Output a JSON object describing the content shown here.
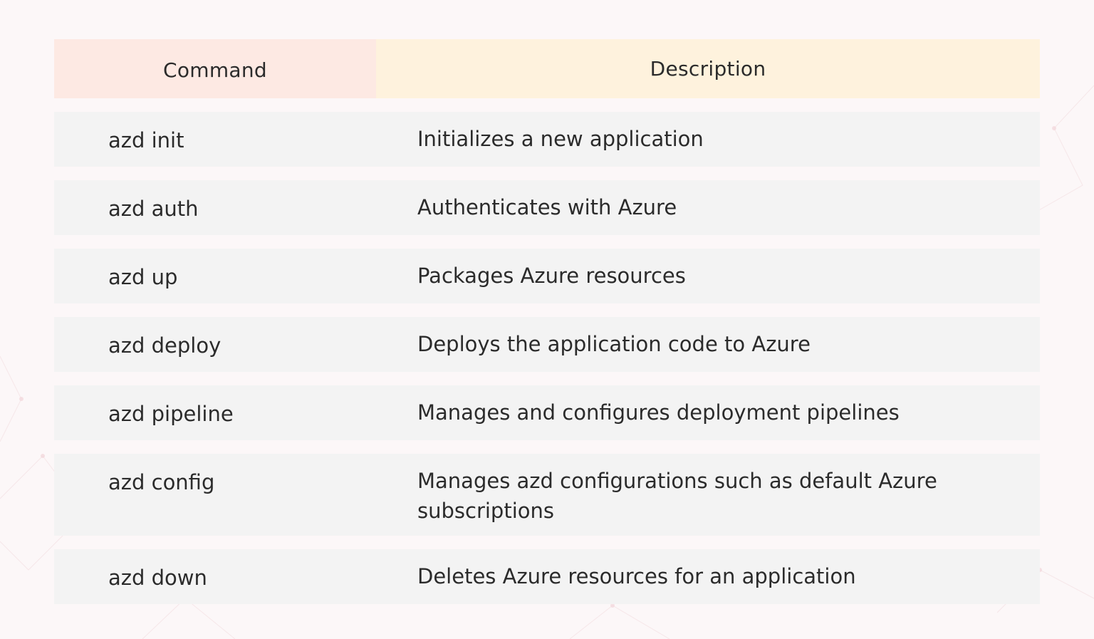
{
  "table": {
    "headers": {
      "command": "Command",
      "description": "Description"
    },
    "rows": [
      {
        "command": "azd init",
        "description": "Initializes a new application"
      },
      {
        "command": "azd auth",
        "description": "Authenticates with Azure"
      },
      {
        "command": "azd up",
        "description": "Packages Azure resources"
      },
      {
        "command": "azd deploy",
        "description": "Deploys the application code to Azure"
      },
      {
        "command": "azd pipeline",
        "description": "Manages and configures deployment pipelines"
      },
      {
        "command": "azd config",
        "description": "Manages azd configurations such as default Azure subscriptions"
      },
      {
        "command": "azd down",
        "description": "Deletes Azure resources for an application"
      }
    ]
  },
  "colors": {
    "page_background": "#fcf7f8",
    "command_header_bg": "#fde9e3",
    "description_header_bg": "#fef2dd",
    "row_bg": "#f3f3f3",
    "text": "#2b2b2b"
  }
}
